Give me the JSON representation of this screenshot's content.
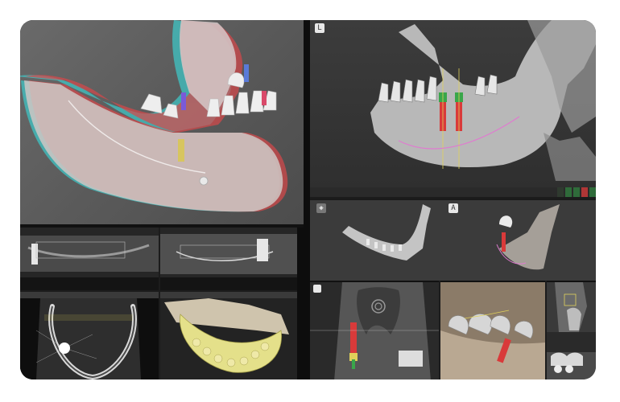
{
  "colors": {
    "frame_bg": "#1c1c1c",
    "anaglyph_red": "#d9484a",
    "anaglyph_cyan": "#3fc5c5",
    "bone": "#bdbdbd",
    "implant_green": "#3aa64a",
    "implant_red": "#d93a3a",
    "nerve_pink": "#e07ad0",
    "model_yellow": "#e4e08a"
  },
  "panels": {
    "anaglyph_view": {
      "icons": [
        "mandible-3d-anaglyph",
        "implant-marker"
      ]
    },
    "planning_view": {
      "badge": "L",
      "status_items": [
        {
          "label": "",
          "color": "#2f3a2f"
        },
        {
          "label": "",
          "color": "#2f6b3a"
        },
        {
          "label": "",
          "color": "#2f6b3a"
        },
        {
          "label": "",
          "color": "#b03636"
        },
        {
          "label": "",
          "color": "#2f6b3a"
        }
      ]
    },
    "dual_3d_view": {
      "badge": "A"
    },
    "coronal_view": {
      "badge": ""
    },
    "axial_view": {
      "toolbar_label": ""
    },
    "model_view": {
      "toolbar_label": ""
    }
  }
}
